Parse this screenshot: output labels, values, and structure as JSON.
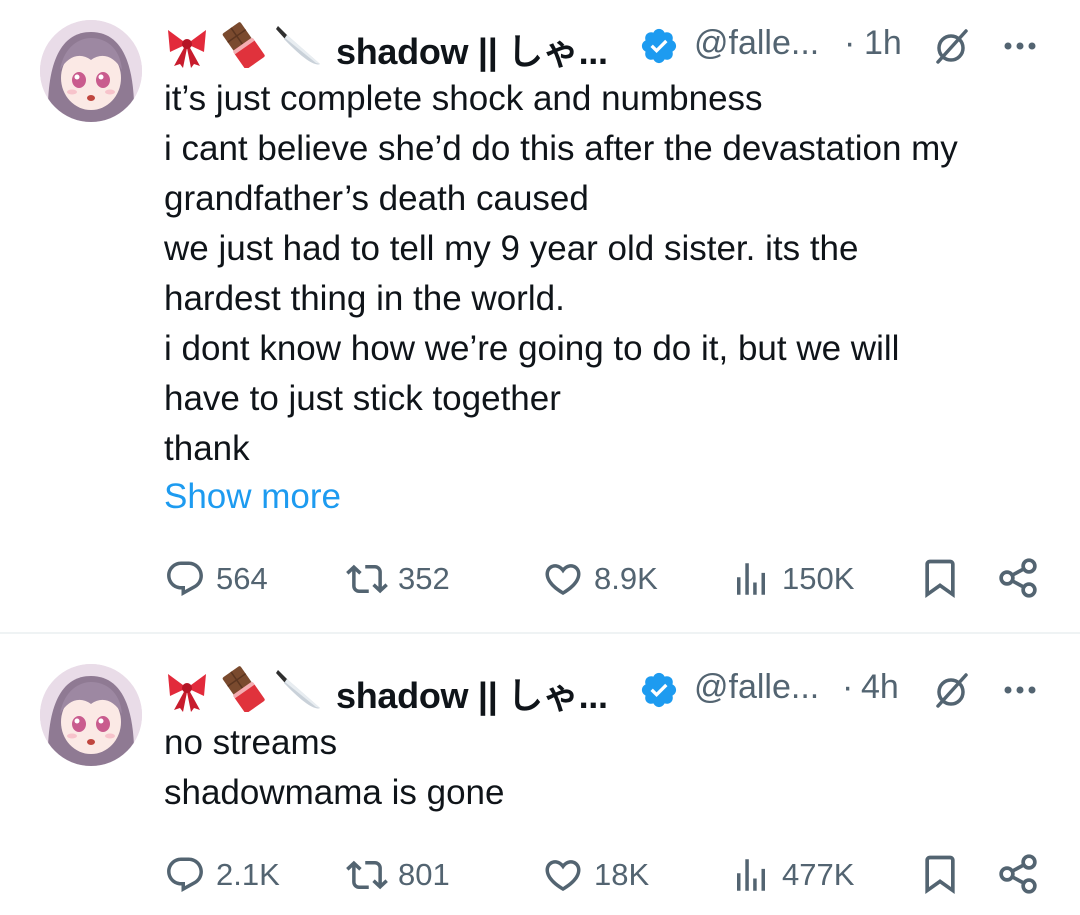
{
  "tweets": [
    {
      "display_name": "shadow || しゃ...",
      "handle": "@falle...",
      "separator": "·",
      "time": "1h",
      "body_lines": [
        "it’s just complete shock and numbness",
        "i cant believe she’d do this after the devastation my",
        "grandfather’s death caused",
        "we just had to tell my 9 year old sister. its the",
        "hardest thing in the world.",
        "i dont know how we’re going to do it, but we will",
        "have to just stick together",
        "thank"
      ],
      "show_more": "Show more",
      "replies": "564",
      "reposts": "352",
      "likes": "8.9K",
      "views": "150K"
    },
    {
      "display_name": "shadow || しゃ...",
      "handle": "@falle...",
      "separator": "·",
      "time": "4h",
      "body_lines": [
        "no streams",
        "shadowmama is gone"
      ],
      "replies": "2.1K",
      "reposts": "801",
      "likes": "18K",
      "views": "477K"
    }
  ],
  "name_emojis": [
    "ribbon-emoji",
    "chocolate-bar-emoji",
    "kitchen-knife-emoji"
  ],
  "colors": {
    "verified_blue": "#1d9bf0",
    "link_blue": "#1d9bf0",
    "secondary_text": "#536471",
    "primary_text": "#0f1419",
    "divider": "#eff3f4"
  },
  "icons": {
    "reply": "reply-icon",
    "repost": "repost-icon",
    "like": "heart-icon",
    "views": "views-icon",
    "bookmark": "bookmark-icon",
    "share": "share-icon",
    "grok": "grok-icon",
    "more": "more-icon",
    "verified": "verified-badge-icon"
  }
}
